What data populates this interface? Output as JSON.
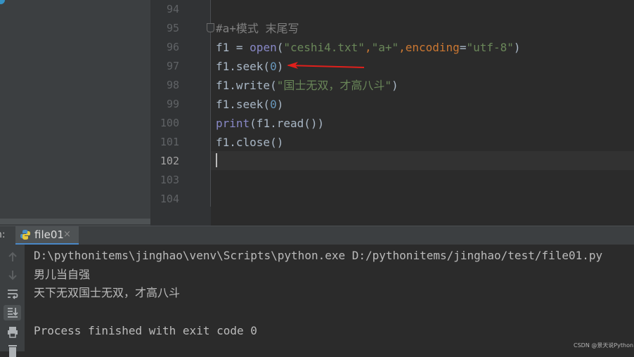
{
  "gutter": {
    "line_numbers": [
      "94",
      "95",
      "96",
      "97",
      "98",
      "99",
      "100",
      "101",
      "102",
      "103",
      "104"
    ],
    "current_line": "102"
  },
  "code": {
    "l95": {
      "comment": "#a+模式 末尾写"
    },
    "l96": {
      "a": "f1 = ",
      "b": "open",
      "c": "(",
      "d": "\"ceshi4.txt\"",
      "e": ",",
      "f": "\"a+\"",
      "g": ",",
      "h": "encoding",
      "i": "=",
      "j": "\"utf-8\"",
      "k": ")"
    },
    "l97": {
      "a": "f1.seek(",
      "b": "0",
      "c": ")"
    },
    "l98": {
      "a": "f1.write(",
      "b": "\"国士无双，才高八斗\"",
      "c": ")"
    },
    "l99": {
      "a": "f1.seek(",
      "b": "0",
      "c": ")"
    },
    "l100": {
      "a": "print",
      "b": "(f1.read())"
    },
    "l101": {
      "a": "f1.close()"
    }
  },
  "annotation": {
    "arrow_color": "#e0201c"
  },
  "run": {
    "label": "n:",
    "tab_label": "file01",
    "tab_close": "×",
    "output": [
      "D:\\pythonitems\\jinghao\\venv\\Scripts\\python.exe D:/pythonitems/jinghao/test/file01.py",
      "男儿当自强",
      "天下无双国士无双，才高八斗",
      "",
      "Process finished with exit code 0"
    ]
  },
  "watermark": "CSDN @景天说Python",
  "colors": {
    "comment": "#808080",
    "string": "#6a8759",
    "number": "#6897bb",
    "keyword": "#cc7832",
    "builtin": "#8888c6",
    "text": "#a9b7c6"
  }
}
